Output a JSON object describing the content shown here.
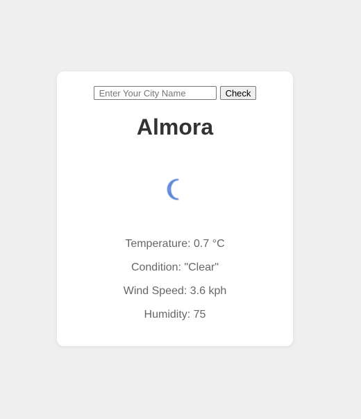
{
  "search": {
    "placeholder": "Enter Your City Name",
    "button_label": "Check"
  },
  "weather": {
    "city": "Almora",
    "icon": "crescent-moon-icon",
    "icon_color": "#5b86d6",
    "temperature_text": "Temperature: 0.7 °C",
    "condition_text": "Condition: \"Clear\"",
    "wind_text": "Wind Speed: 3.6 kph",
    "humidity_text": "Humidity: 75"
  }
}
